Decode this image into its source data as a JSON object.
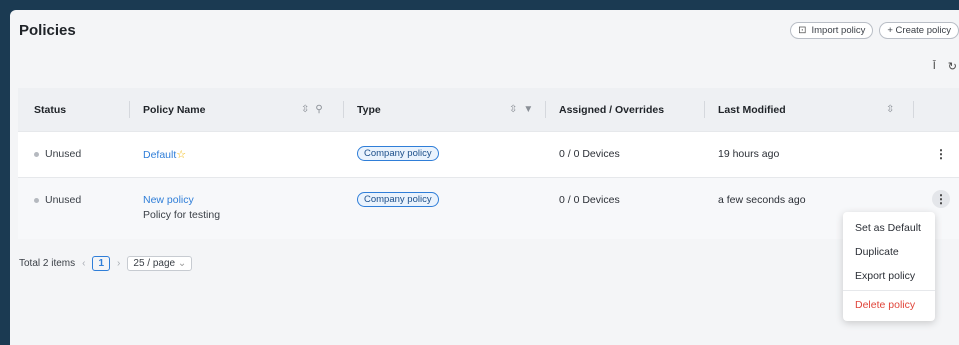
{
  "header": {
    "title": "Policies",
    "import_label": "Import policy",
    "create_label": "+ Create policy"
  },
  "table": {
    "columns": [
      "Status",
      "Policy Name",
      "Type",
      "Assigned / Overrides",
      "Last Modified"
    ],
    "rows": [
      {
        "status": "Unused",
        "name": "Default",
        "description": "",
        "type": "Company policy",
        "assigned": "0 / 0 Devices",
        "modified": "19 hours ago",
        "is_default": true
      },
      {
        "status": "Unused",
        "name": "New policy",
        "description": "Policy for testing",
        "type": "Company policy",
        "assigned": "0 / 0 Devices",
        "modified": "a few seconds ago",
        "is_default": false
      }
    ]
  },
  "pagination": {
    "total": "Total 2 items",
    "current_page": "1",
    "page_size": "25 / page"
  },
  "context_menu": {
    "items": [
      "Set as Default",
      "Duplicate",
      "Export policy",
      "Delete policy"
    ]
  },
  "colors": {
    "accent": "#2f7ed8",
    "danger": "#e0453a",
    "star": "#f0b400",
    "background": "#1b3a52"
  },
  "icons": [
    "import-icon",
    "plus-icon",
    "column-height-icon",
    "refresh-icon",
    "sort-icon",
    "search-icon",
    "filter-icon",
    "star-icon",
    "kebab-icon"
  ]
}
